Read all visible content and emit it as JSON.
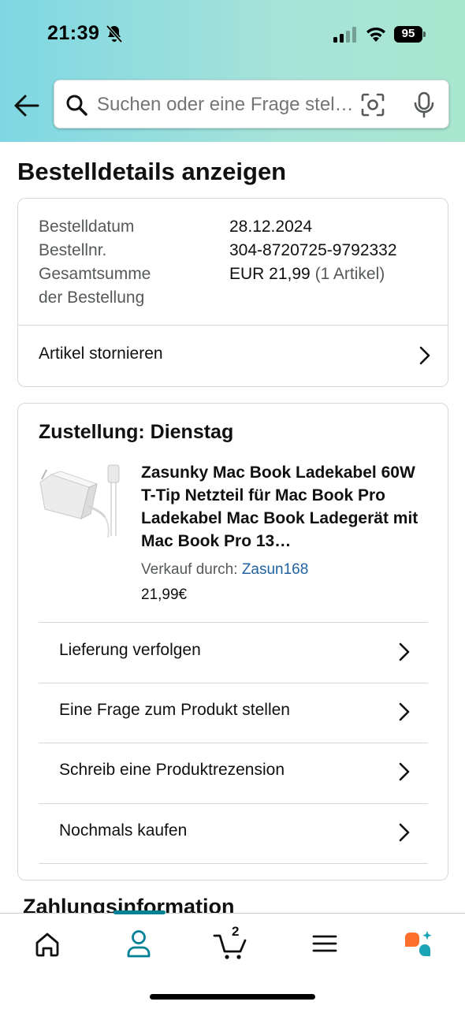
{
  "status_bar": {
    "time": "21:39",
    "battery": "95"
  },
  "search": {
    "placeholder": "Suchen oder eine Frage stellen"
  },
  "page": {
    "title": "Bestelldetails anzeigen"
  },
  "order": {
    "date_label": "Bestelldatum",
    "date": "28.12.2024",
    "number_label": "Bestellnr.",
    "number": "304-8720725-9792332",
    "total_label_line1": "Gesamtsumme",
    "total_label_line2": "der Bestellung",
    "total": "EUR 21,99",
    "total_count": "(1 Artikel)",
    "cancel_label": "Artikel stornieren"
  },
  "delivery": {
    "title": "Zustellung: Dienstag",
    "product_title": "Zasunky Mac Book Ladekabel 60W T-Tip Netzteil für Mac Book Pro Ladekabel Mac Book Ladegerät mit Mac Book Pro 13…",
    "seller_prefix": "Verkauf durch:",
    "seller_name": "Zasun168",
    "price": "21,99€",
    "actions": [
      {
        "label": "Lieferung verfolgen"
      },
      {
        "label": "Eine Frage zum Produkt stellen"
      },
      {
        "label": "Schreib eine Produktrezension"
      },
      {
        "label": "Nochmals kaufen"
      }
    ]
  },
  "payment": {
    "title": "Zahlungsinformation"
  },
  "bottom_nav": {
    "items": [
      "home-icon",
      "account-icon",
      "cart-icon",
      "menu-icon",
      "rufus-icon"
    ],
    "active": "account-icon",
    "cart_count": "2",
    "accent": "#008296"
  }
}
